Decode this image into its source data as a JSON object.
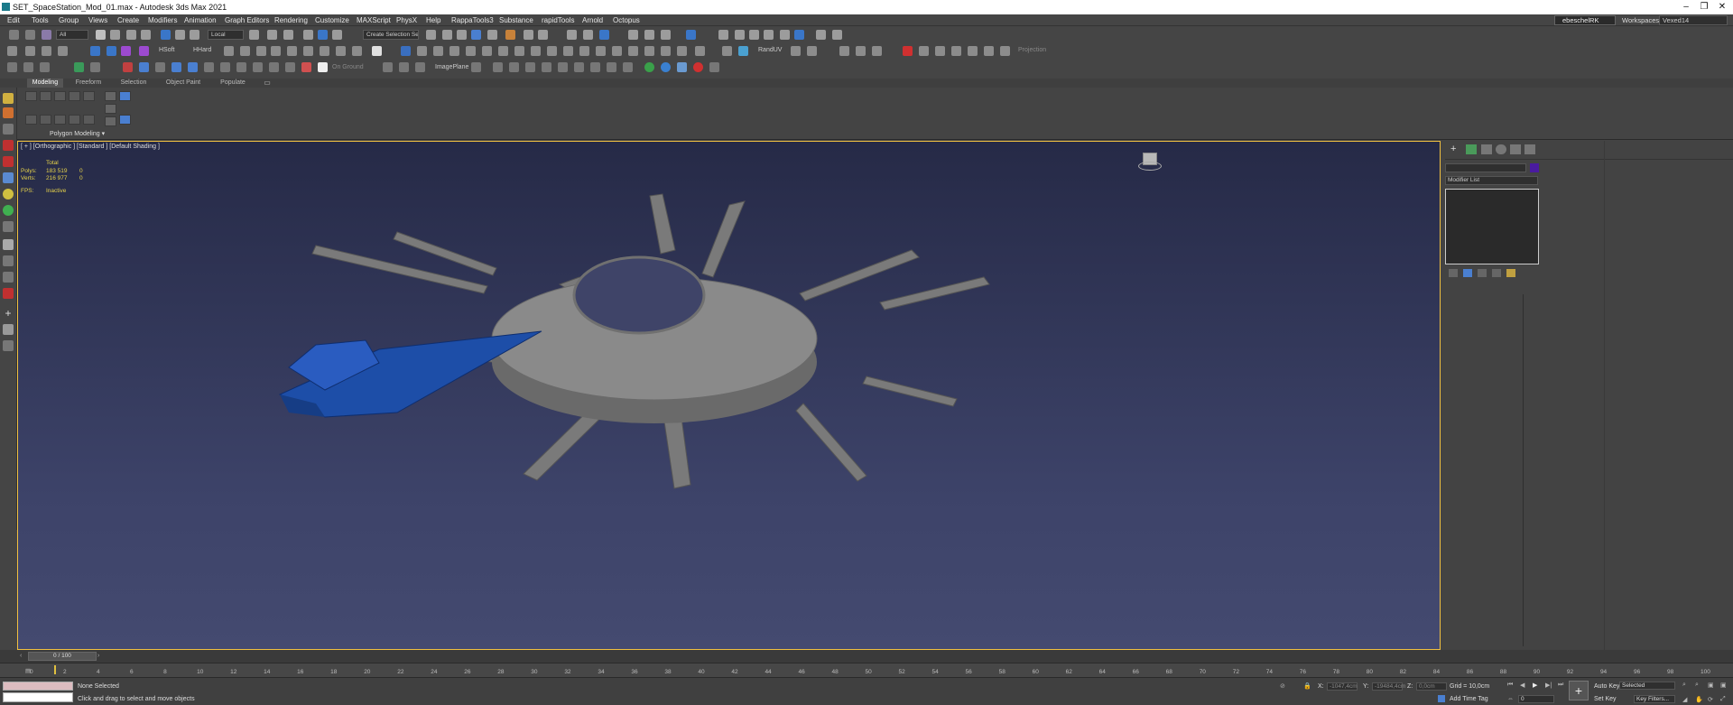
{
  "window": {
    "title": "SET_SpaceStation_Mod_01.max - Autodesk 3ds Max 2021",
    "minimize": "–",
    "maximize": "❐",
    "close": "✕"
  },
  "menu": [
    "Edit",
    "Tools",
    "Group",
    "Views",
    "Create",
    "Modifiers",
    "Animation",
    "Graph Editors",
    "Rendering",
    "Customize",
    "MAXScript",
    "PhysX",
    "Help",
    "RappaTools3",
    "Substance",
    "rapidTools",
    "Arnold",
    "Octopus"
  ],
  "account": {
    "user": "ebeschelRK",
    "workspaces_label": "Workspaces:",
    "workspace": "Vexed14"
  },
  "toolbar": {
    "filter_all": "All",
    "ref_coord": "Local",
    "selection_set": "Create Selection Se",
    "hsoft": "HSoft",
    "hhard": "HHard",
    "randuv": "RandUV",
    "projection": "Projection",
    "on_ground": "On Ground",
    "image_plane": "ImagePlane"
  },
  "ribbon": {
    "tabs": [
      "Modeling",
      "Freeform",
      "Selection",
      "Object Paint",
      "Populate"
    ],
    "panel_label": "Polygon Modeling ▾"
  },
  "viewport": {
    "label": "[ + ] [Orthographic ] [Standard ] [Default Shading ]",
    "stats": {
      "total_label": "Total",
      "polys_label": "Polys:",
      "polys": "183 519",
      "polys_sel": "0",
      "verts_label": "Verts:",
      "verts": "216 977",
      "verts_sel": "0",
      "fps_label": "FPS:",
      "fps": "Inactive"
    }
  },
  "command_panel": {
    "modifier_list": "Modifier List"
  },
  "timeline": {
    "frame": "0 / 100"
  },
  "ruler_ticks": [
    "0",
    "2",
    "4",
    "6",
    "8",
    "10",
    "12",
    "14",
    "16",
    "18",
    "20",
    "22",
    "24",
    "26",
    "28",
    "30",
    "32",
    "34",
    "36",
    "38",
    "40",
    "42",
    "44",
    "46",
    "48",
    "50",
    "52",
    "54",
    "56",
    "58",
    "60",
    "62",
    "64",
    "66",
    "68",
    "70",
    "72",
    "74",
    "76",
    "78",
    "80",
    "82",
    "84",
    "86",
    "88",
    "90",
    "92",
    "94",
    "96",
    "98",
    "100"
  ],
  "status": {
    "selection": "None Selected",
    "prompt": "Click and drag to select and move objects",
    "x_label": "X:",
    "x_value": "-1047,4cm",
    "y_label": "Y:",
    "y_value": "-19484,4cm",
    "z_label": "Z:",
    "z_value": "0,0cm",
    "grid": "Grid = 10,0cm",
    "add_time_tag": "Add Time Tag",
    "auto_key": "Auto Key",
    "set_key": "Set Key",
    "key_mode": "Selected",
    "key_filters": "Key Filters...",
    "current_frame": "0"
  }
}
